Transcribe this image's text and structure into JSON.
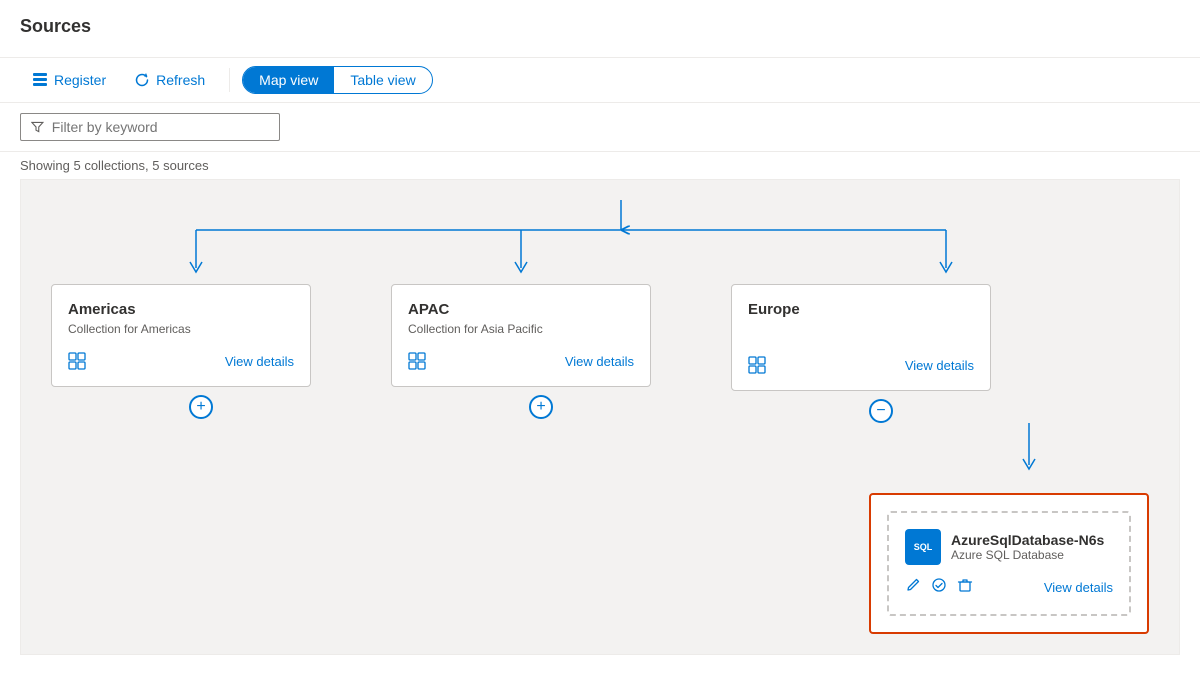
{
  "header": {
    "title": "Sources"
  },
  "toolbar": {
    "register_label": "Register",
    "refresh_label": "Refresh",
    "map_view_label": "Map view",
    "table_view_label": "Table view"
  },
  "filter": {
    "placeholder": "Filter by keyword"
  },
  "showing_label": "Showing 5 collections, 5 sources",
  "collections": [
    {
      "id": "americas",
      "title": "Americas",
      "description": "Collection for Americas",
      "view_details": "View details",
      "expand": "+"
    },
    {
      "id": "apac",
      "title": "APAC",
      "description": "Collection for Asia Pacific",
      "view_details": "View details",
      "expand": "+"
    },
    {
      "id": "europe",
      "title": "Europe",
      "description": "",
      "view_details": "View details",
      "expand": "−"
    }
  ],
  "source": {
    "name": "AzureSqlDatabase-N6s",
    "type": "Azure SQL Database",
    "view_details": "View details",
    "icon_text": "SQL"
  }
}
